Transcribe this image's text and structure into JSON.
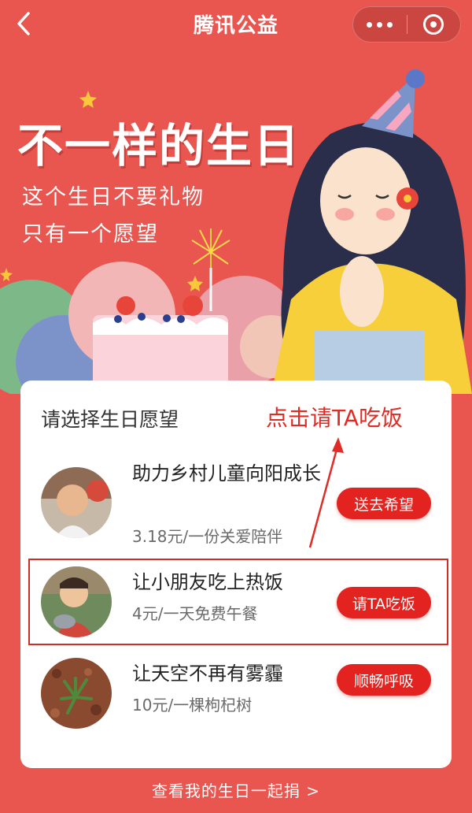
{
  "navbar": {
    "title": "腾讯公益",
    "back_icon": "chevron-left-icon",
    "more_icon": "more-dots-icon",
    "close_icon": "miniprogram-close-icon"
  },
  "hero": {
    "title": "不一样的生日",
    "subtitle_line1": "这个生日不要礼物",
    "subtitle_line2": "只有一个愿望"
  },
  "wish_card": {
    "heading": "请选择生日愿望",
    "annotation": "点击请TA吃饭",
    "items": [
      {
        "title": "助力乡村儿童向阳成长",
        "subtitle": "3.18元/一份关爱陪伴",
        "button": "送去希望",
        "image": "child-photo"
      },
      {
        "title": "让小朋友吃上热饭",
        "subtitle": "4元/一天免费午餐",
        "button": "请TA吃饭",
        "image": "child-meal-photo"
      },
      {
        "title": "让天空不再有雾霾",
        "subtitle": "10元/一棵枸杞树",
        "button": "顺畅呼吸",
        "image": "seedling-photo"
      }
    ]
  },
  "footer": {
    "link": "查看我的生日一起捐 >"
  },
  "colors": {
    "background": "#e8564f",
    "button": "#e2231f",
    "annotation": "#e12b25"
  }
}
